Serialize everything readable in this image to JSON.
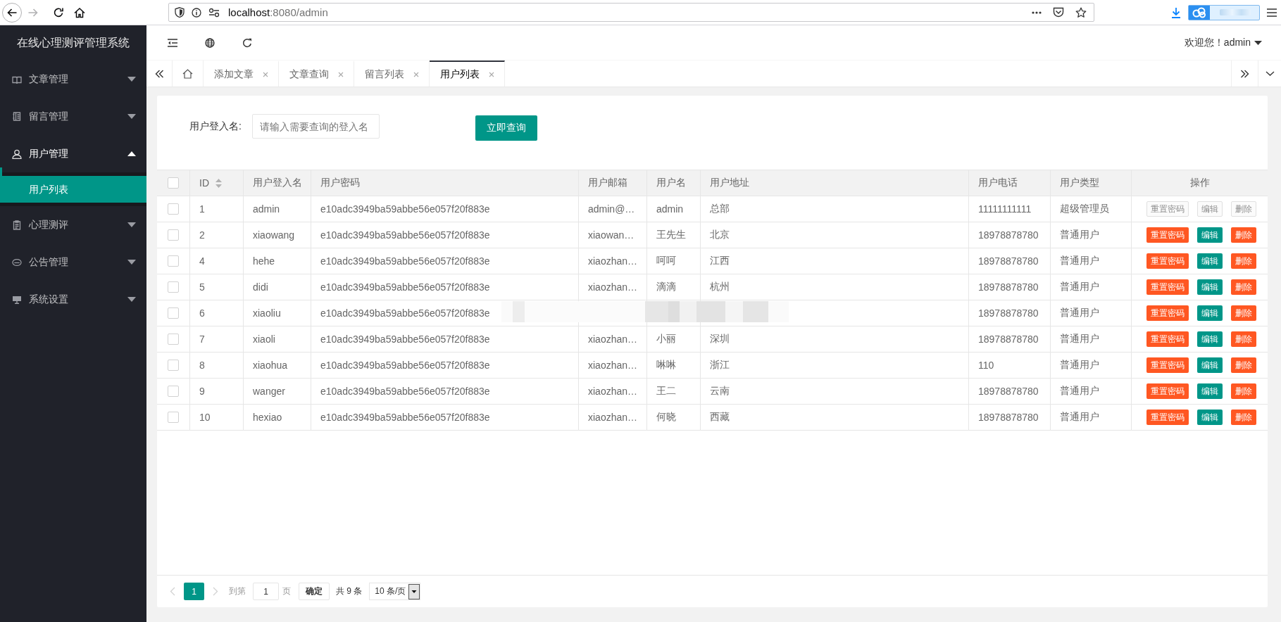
{
  "browser": {
    "nav": [
      {
        "kind": "back",
        "disabled": false
      },
      {
        "kind": "forward",
        "disabled": true
      },
      {
        "kind": "reload",
        "disabled": false
      },
      {
        "kind": "home",
        "disabled": false
      }
    ],
    "url": {
      "host": "localhost",
      "path": ":8080/admin"
    }
  },
  "sidebar": {
    "title": "在线心理测评管理系统",
    "items": [
      {
        "label": "文章管理",
        "expanded": false
      },
      {
        "label": "留言管理",
        "expanded": false
      },
      {
        "label": "用户管理",
        "expanded": true,
        "children": [
          {
            "label": "用户列表",
            "selected": true
          }
        ]
      },
      {
        "label": "心理测评",
        "expanded": false
      },
      {
        "label": "公告管理",
        "expanded": false
      },
      {
        "label": "系统设置",
        "expanded": false
      }
    ]
  },
  "header": {
    "welcome": "欢迎您！admin"
  },
  "tabs": [
    {
      "label": "添加文章",
      "selected": false
    },
    {
      "label": "文章查询",
      "selected": false
    },
    {
      "label": "留言列表",
      "selected": false
    },
    {
      "label": "用户列表",
      "selected": true
    }
  ],
  "search": {
    "label": "用户登入名:",
    "placeholder": "请输入需要查询的登入名",
    "button": "立即查询"
  },
  "table": {
    "select_all": {
      "checked": false
    },
    "columns": [
      {
        "label": "ID",
        "sortable": true
      },
      {
        "label": "用户登入名",
        "sortable": false
      },
      {
        "label": "用户密码",
        "sortable": false
      },
      {
        "label": "用户邮箱",
        "sortable": false
      },
      {
        "label": "用户名",
        "sortable": false
      },
      {
        "label": "用户地址",
        "sortable": false
      },
      {
        "label": "用户电话",
        "sortable": false
      },
      {
        "label": "用户类型",
        "sortable": false
      },
      {
        "label": "操作",
        "sortable": false
      }
    ],
    "rows": [
      {
        "checked": false,
        "redacted": false,
        "id": "1",
        "login": "admin",
        "password": "e10adc3949ba59abbe56e057f20f883e",
        "email": "admin@…",
        "name": "admin",
        "address": "总部",
        "phone": "11111111111",
        "type": "超级管理员",
        "actions": [
          {
            "label": "重置密码",
            "kind": "danger",
            "disabled": true
          },
          {
            "label": "编辑",
            "kind": "primary",
            "disabled": true
          },
          {
            "label": "删除",
            "kind": "danger",
            "disabled": true
          }
        ]
      },
      {
        "checked": false,
        "redacted": false,
        "id": "2",
        "login": "xiaowang",
        "password": "e10adc3949ba59abbe56e057f20f883e",
        "email": "xiaowan…",
        "name": "王先生",
        "address": "北京",
        "phone": "18978878780",
        "type": "普通用户",
        "actions": [
          {
            "label": "重置密码",
            "kind": "danger",
            "disabled": false
          },
          {
            "label": "编辑",
            "kind": "primary",
            "disabled": false
          },
          {
            "label": "删除",
            "kind": "danger",
            "disabled": false
          }
        ]
      },
      {
        "checked": false,
        "redacted": false,
        "id": "4",
        "login": "hehe",
        "password": "e10adc3949ba59abbe56e057f20f883e",
        "email": "xiaozhan…",
        "name": "呵呵",
        "address": "江西",
        "phone": "18978878780",
        "type": "普通用户",
        "actions": [
          {
            "label": "重置密码",
            "kind": "danger",
            "disabled": false
          },
          {
            "label": "编辑",
            "kind": "primary",
            "disabled": false
          },
          {
            "label": "删除",
            "kind": "danger",
            "disabled": false
          }
        ]
      },
      {
        "checked": false,
        "redacted": false,
        "id": "5",
        "login": "didi",
        "password": "e10adc3949ba59abbe56e057f20f883e",
        "email": "xiaozhan…",
        "name": "滴滴",
        "address": "杭州",
        "phone": "18978878780",
        "type": "普通用户",
        "actions": [
          {
            "label": "重置密码",
            "kind": "danger",
            "disabled": false
          },
          {
            "label": "编辑",
            "kind": "primary",
            "disabled": false
          },
          {
            "label": "删除",
            "kind": "danger",
            "disabled": false
          }
        ]
      },
      {
        "checked": false,
        "redacted": true,
        "id": "6",
        "login": "xiaoliu",
        "password": "e10adc3949ba59abbe56e057f20f883e",
        "phone": "18978878780",
        "type": "普通用户",
        "actions": [
          {
            "label": "重置密码",
            "kind": "danger",
            "disabled": false
          },
          {
            "label": "编辑",
            "kind": "primary",
            "disabled": false
          },
          {
            "label": "删除",
            "kind": "danger",
            "disabled": false
          }
        ]
      },
      {
        "checked": false,
        "redacted": false,
        "id": "7",
        "login": "xiaoli",
        "password": "e10adc3949ba59abbe56e057f20f883e",
        "email": "xiaozhan…",
        "name": "小丽",
        "address": "深圳",
        "phone": "18978878780",
        "type": "普通用户",
        "actions": [
          {
            "label": "重置密码",
            "kind": "danger",
            "disabled": false
          },
          {
            "label": "编辑",
            "kind": "primary",
            "disabled": false
          },
          {
            "label": "删除",
            "kind": "danger",
            "disabled": false
          }
        ]
      },
      {
        "checked": false,
        "redacted": false,
        "id": "8",
        "login": "xiaohua",
        "password": "e10adc3949ba59abbe56e057f20f883e",
        "email": "xiaozhan…",
        "name": "啉啉",
        "address": "浙江",
        "phone": "110",
        "type": "普通用户",
        "actions": [
          {
            "label": "重置密码",
            "kind": "danger",
            "disabled": false
          },
          {
            "label": "编辑",
            "kind": "primary",
            "disabled": false
          },
          {
            "label": "删除",
            "kind": "danger",
            "disabled": false
          }
        ]
      },
      {
        "checked": false,
        "redacted": false,
        "id": "9",
        "login": "wanger",
        "password": "e10adc3949ba59abbe56e057f20f883e",
        "email": "xiaozhan…",
        "name": "王二",
        "address": "云南",
        "phone": "18978878780",
        "type": "普通用户",
        "actions": [
          {
            "label": "重置密码",
            "kind": "danger",
            "disabled": false
          },
          {
            "label": "编辑",
            "kind": "primary",
            "disabled": false
          },
          {
            "label": "删除",
            "kind": "danger",
            "disabled": false
          }
        ]
      },
      {
        "checked": false,
        "redacted": false,
        "id": "10",
        "login": "hexiao",
        "password": "e10adc3949ba59abbe56e057f20f883e",
        "email": "xiaozhan…",
        "name": "何晓",
        "address": "西藏",
        "phone": "18978878780",
        "type": "普通用户",
        "actions": [
          {
            "label": "重置密码",
            "kind": "danger",
            "disabled": false
          },
          {
            "label": "编辑",
            "kind": "primary",
            "disabled": false
          },
          {
            "label": "删除",
            "kind": "danger",
            "disabled": false
          }
        ]
      }
    ]
  },
  "pagination": {
    "prev": {
      "disabled": true
    },
    "pages": [
      {
        "label": "1",
        "selected": true
      }
    ],
    "next": {
      "disabled": true
    },
    "goto_label": "到第",
    "goto_value": "1",
    "goto_unit": "页",
    "confirm": "确定",
    "total": "共 9 条",
    "page_size": "10 条/页"
  }
}
